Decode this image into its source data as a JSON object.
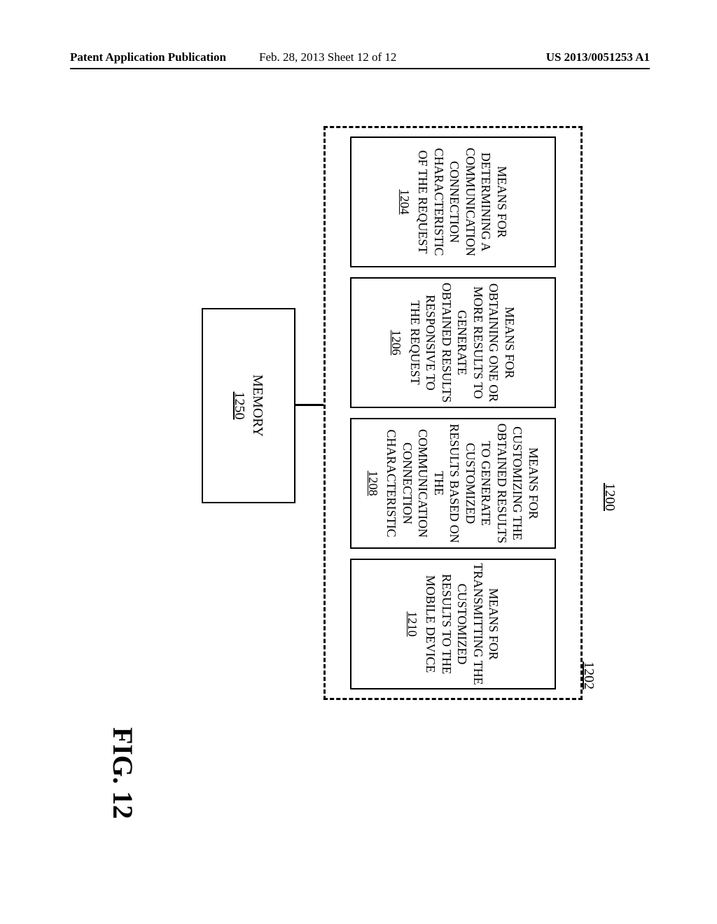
{
  "header": {
    "left": "Patent Application Publication",
    "center": "Feb. 28, 2013  Sheet 12 of 12",
    "right": "US 2013/0051253 A1"
  },
  "refs": {
    "r1200": "1200",
    "r1202": "1202"
  },
  "blocks": {
    "b1204": {
      "text": "MEANS FOR DETERMINING A COMMUNICATION CONNECTION CHARACTERISTIC OF THE REQUEST",
      "ref": "1204"
    },
    "b1206": {
      "text": "MEANS FOR OBTAINING ONE OR MORE RESULTS TO GENERATE OBTAINED RESULTS RESPONSIVE TO THE REQUEST",
      "ref": "1206"
    },
    "b1208": {
      "text": "MEANS FOR CUSTOMIZING THE OBTAINED RESULTS TO GENERATE CUSTOMIZED RESULTS BASED ON THE COMMUNICATION CONNECTION CHARACTERISTIC",
      "ref": "1208"
    },
    "b1210": {
      "text": "MEANS FOR TRANSMITTING THE CUSTOMIZED RESULTS TO THE MOBILE DEVICE",
      "ref": "1210"
    }
  },
  "memory": {
    "label": "MEMORY",
    "ref": "1250"
  },
  "figure_label": "FIG. 12"
}
